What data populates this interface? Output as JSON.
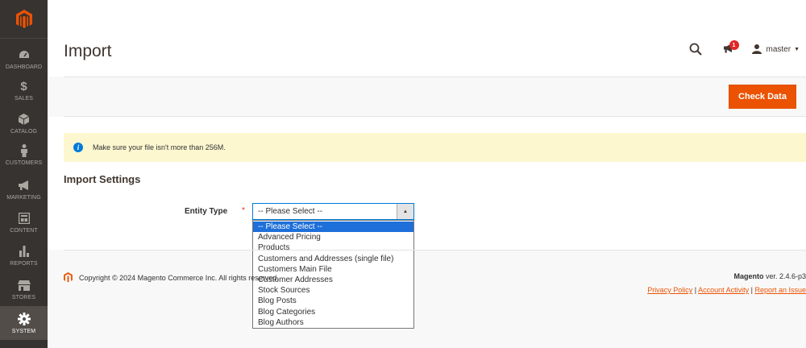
{
  "sidebar": {
    "items": [
      {
        "label": "DASHBOARD",
        "icon": "dashboard-icon"
      },
      {
        "label": "SALES",
        "icon": "dollar-icon"
      },
      {
        "label": "CATALOG",
        "icon": "cube-icon"
      },
      {
        "label": "CUSTOMERS",
        "icon": "person-icon"
      },
      {
        "label": "MARKETING",
        "icon": "megaphone-icon"
      },
      {
        "label": "CONTENT",
        "icon": "content-icon"
      },
      {
        "label": "REPORTS",
        "icon": "bar-chart-icon"
      },
      {
        "label": "STORES",
        "icon": "store-icon"
      },
      {
        "label": "SYSTEM",
        "icon": "gear-icon"
      }
    ]
  },
  "header": {
    "title": "Import",
    "notification_count": "1",
    "username": "master"
  },
  "actionbar": {
    "check_data_label": "Check Data"
  },
  "notice": {
    "text": "Make sure your file isn't more than 256M."
  },
  "import_settings": {
    "section_title": "Import Settings",
    "entity_type_label": "Entity Type",
    "required_mark": "*",
    "selected_value": "-- Please Select --",
    "options": [
      "-- Please Select --",
      "Advanced Pricing",
      "Products",
      "Customers and Addresses (single file)",
      "Customers Main File",
      "Customer Addresses",
      "Stock Sources",
      "Blog Posts",
      "Blog Categories",
      "Blog Authors"
    ]
  },
  "footer": {
    "copyright": "Copyright © 2024 Magento Commerce Inc. All rights reserved.",
    "brand": "Magento",
    "version": " ver. 2.4.6-p3",
    "privacy_link": "Privacy Policy",
    "activity_link": "Account Activity",
    "report_link": "Report an Issue"
  },
  "colors": {
    "accent": "#eb5202",
    "sidebar_bg": "#373330",
    "notice_bg": "#fdf7d0",
    "selected_option": "#1e6fd9"
  }
}
